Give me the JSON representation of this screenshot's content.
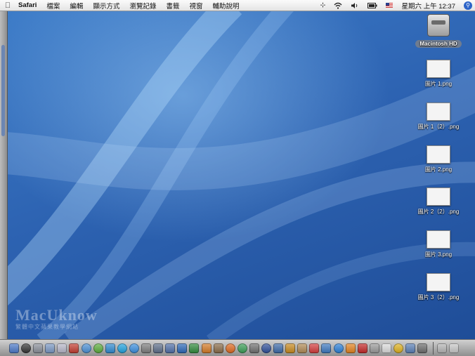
{
  "menubar": {
    "app": "Safari",
    "menus": [
      "檔案",
      "編輯",
      "顯示方式",
      "瀏覽記錄",
      "書籤",
      "視窗",
      "輔助說明"
    ],
    "clock": "星期六 上午 12:37",
    "status_icons": [
      "bluetooth-icon",
      "wifi-icon",
      "volume-icon",
      "battery-icon",
      "input-flag-icon",
      "spotlight-icon"
    ]
  },
  "desktop": {
    "icons": [
      {
        "label": "Macintosh HD",
        "kind": "hard-drive"
      },
      {
        "label": "圖片 1.png",
        "kind": "image-file"
      },
      {
        "label": "圖片 1（2）.png",
        "kind": "image-file"
      },
      {
        "label": "圖片 2.png",
        "kind": "image-file"
      },
      {
        "label": "圖片 2（2）.png",
        "kind": "image-file"
      },
      {
        "label": "圖片 3.png",
        "kind": "image-file"
      },
      {
        "label": "圖片 3（2）.png",
        "kind": "image-file"
      }
    ],
    "watermark": {
      "title": "MacUknow",
      "subtitle": "繁體中文蘋果教學網站"
    }
  },
  "dock": {
    "apps": [
      {
        "name": "finder-icon",
        "color": "#4a78c8"
      },
      {
        "name": "dashboard-icon",
        "color": "#333333"
      },
      {
        "name": "system-preferences-icon",
        "color": "#8a8f99"
      },
      {
        "name": "preview-icon",
        "color": "#7a98c4"
      },
      {
        "name": "photo-icon",
        "color": "#b7b7c9"
      },
      {
        "name": "acrobat-icon",
        "color": "#c33b2f"
      },
      {
        "name": "safari-icon",
        "color": "#4a90d6"
      },
      {
        "name": "adium-icon",
        "color": "#5cae3c"
      },
      {
        "name": "chat-figure-icon",
        "color": "#2f8ad0"
      },
      {
        "name": "skype-icon",
        "color": "#1fa3e0"
      },
      {
        "name": "ichat-icon",
        "color": "#3a8fe0"
      },
      {
        "name": "network-icon",
        "color": "#7d7d7d"
      },
      {
        "name": "pen-tool-icon",
        "color": "#5d6e8a"
      },
      {
        "name": "photo-tool-icon",
        "color": "#4f6fa8"
      },
      {
        "name": "word-icon",
        "color": "#2a67b8"
      },
      {
        "name": "excel-icon",
        "color": "#2f8a3a"
      },
      {
        "name": "powerpoint-icon",
        "color": "#d47a24"
      },
      {
        "name": "dictionary-icon",
        "color": "#8a6b48"
      },
      {
        "name": "firefox-icon",
        "color": "#e06a1f"
      },
      {
        "name": "itunes-icon",
        "color": "#3a9e56"
      },
      {
        "name": "imovie-icon",
        "color": "#6f6f6f"
      },
      {
        "name": "idvd-icon",
        "color": "#2e4e9a"
      },
      {
        "name": "iphoto-icon",
        "color": "#3c6aa8"
      },
      {
        "name": "garageband-icon",
        "color": "#c88a1e"
      },
      {
        "name": "address-book-icon",
        "color": "#b08a55"
      },
      {
        "name": "ical-icon",
        "color": "#d43b3b"
      },
      {
        "name": "mail-icon",
        "color": "#3c78c0"
      },
      {
        "name": "globe-icon",
        "color": "#2a80d8"
      },
      {
        "name": "vlc-icon",
        "color": "#e3821e"
      },
      {
        "name": "flashget-icon",
        "color": "#c42727"
      },
      {
        "name": "disk-utility-icon",
        "color": "#9a9a9a"
      },
      {
        "name": "terminal-icon",
        "color": "#dcdcdc"
      },
      {
        "name": "norton-icon",
        "color": "#e0b21e"
      },
      {
        "name": "migration-icon",
        "color": "#5a7fb6"
      },
      {
        "name": "script-editor-icon",
        "color": "#6c6c6c"
      }
    ],
    "trailing": [
      {
        "name": "documents-stack-icon",
        "color": "#b5b5b5"
      },
      {
        "name": "trash-icon",
        "color": "#c9c9c9"
      }
    ]
  }
}
